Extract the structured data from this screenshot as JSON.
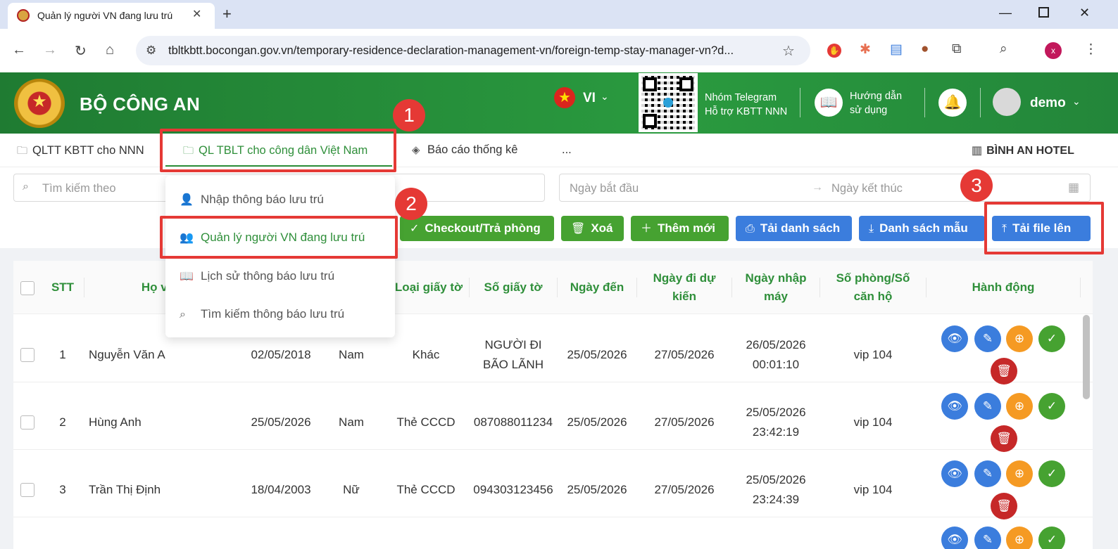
{
  "browser": {
    "tab_title": "Quản lý người VN đang lưu trú",
    "url": "tbltkbtt.bocongan.gov.vn/temporary-residence-declaration-management-vn/foreign-temp-stay-manager-vn?d...",
    "profile_initial": "x"
  },
  "header": {
    "brand": "BỘ CÔNG AN",
    "lang": "VI",
    "telegram_line1": "Nhóm Telegram",
    "telegram_line2": "Hỗ trợ KBTT NNN",
    "guide_line1": "Hướng dẫn",
    "guide_line2": "sử dụng",
    "username": "demo"
  },
  "menu": {
    "items": [
      {
        "label": "QLTT KBTT cho NNN"
      },
      {
        "label": "QL TBLT cho công dân Việt Nam"
      },
      {
        "label": "Báo cáo thống kê"
      },
      {
        "label": "..."
      }
    ],
    "hotel": "BÌNH AN HOTEL"
  },
  "dropdown": {
    "items": [
      {
        "label": "Nhập thông báo lưu trú"
      },
      {
        "label": "Quản lý người VN đang lưu trú"
      },
      {
        "label": "Lịch sử thông báo lưu trú"
      },
      {
        "label": "Tìm kiếm thông báo lưu trú"
      }
    ]
  },
  "filters": {
    "search_placeholder": "Tìm kiếm theo",
    "start_placeholder": "Ngày bắt đầu",
    "end_placeholder": "Ngày kết thúc"
  },
  "actions": {
    "checkout": "Checkout/Trả phòng",
    "delete": "Xoá",
    "add": "Thêm mới",
    "download_list": "Tải danh sách",
    "template": "Danh sách mẫu",
    "upload": "Tải file lên"
  },
  "annotations": [
    "1",
    "2",
    "3"
  ],
  "table": {
    "headers": {
      "stt": "STT",
      "name": "Họ và",
      "doc_type": "Loại giấy tờ",
      "doc_no": "Số giấy tờ",
      "arrival": "Ngày đến",
      "departure_l1": "Ngày đi dự",
      "departure_l2": "kiến",
      "entry_l1": "Ngày nhập",
      "entry_l2": "máy",
      "room_l1": "Số phòng/Số",
      "room_l2": "căn hộ",
      "actions": "Hành động"
    },
    "rows": [
      {
        "stt": "1",
        "name": "Nguyễn Văn A",
        "dob": "02/05/2018",
        "gender": "Nam",
        "doc_type": "Khác",
        "doc_no_l1": "NGƯỜI ĐI",
        "doc_no_l2": "BÃO LÃNH",
        "arrival": "25/05/2026",
        "departure": "27/05/2026",
        "entry_date": "26/05/2026",
        "entry_time": "00:01:10",
        "room": "vip 104"
      },
      {
        "stt": "2",
        "name": "Hùng Anh",
        "dob": "25/05/2026",
        "gender": "Nam",
        "doc_type": "Thẻ CCCD",
        "doc_no_l1": "087088011234",
        "doc_no_l2": "",
        "arrival": "25/05/2026",
        "departure": "27/05/2026",
        "entry_date": "25/05/2026",
        "entry_time": "23:42:19",
        "room": "vip 104"
      },
      {
        "stt": "3",
        "name": "Trần Thị Định",
        "dob": "18/04/2003",
        "gender": "Nữ",
        "doc_type": "Thẻ CCCD",
        "doc_no_l1": "094303123456",
        "doc_no_l2": "",
        "arrival": "25/05/2026",
        "departure": "27/05/2026",
        "entry_date": "25/05/2026",
        "entry_time": "23:24:39",
        "room": "vip 104"
      }
    ]
  },
  "colors": {
    "primary_green": "#2f8f3a",
    "button_blue": "#3b7ddd",
    "annotation_red": "#e53935",
    "warning_orange": "#f59a23",
    "danger_red": "#c62828"
  }
}
